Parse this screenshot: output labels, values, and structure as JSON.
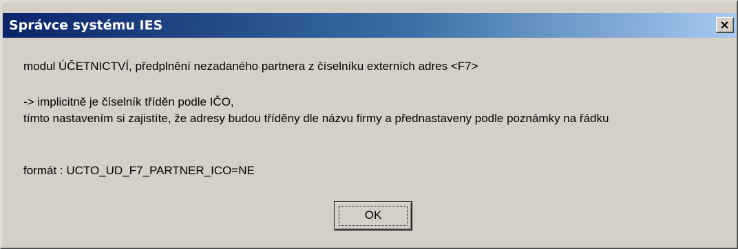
{
  "window": {
    "title": "Správce systému IES",
    "close_icon": "close-icon"
  },
  "message": {
    "line1": "modul ÚČETNICTVÍ, předplnění nezadaného partnera z číselníku externích adres <F7>",
    "line2": "-> implicitně je číselník tříděn podle IČO,",
    "line3": "tímto nastavením si zajistíte, že adresy budou tříděny dle názvu firmy a přednastaveny podle poznámky na řádku",
    "line4": "formát : UCTO_UD_F7_PARTNER_ICO=NE"
  },
  "buttons": {
    "ok_label": "OK"
  },
  "colors": {
    "face": "#d4d0c8",
    "title_start": "#0a246a",
    "title_end": "#a6caf0",
    "title_text": "#ffffff"
  }
}
